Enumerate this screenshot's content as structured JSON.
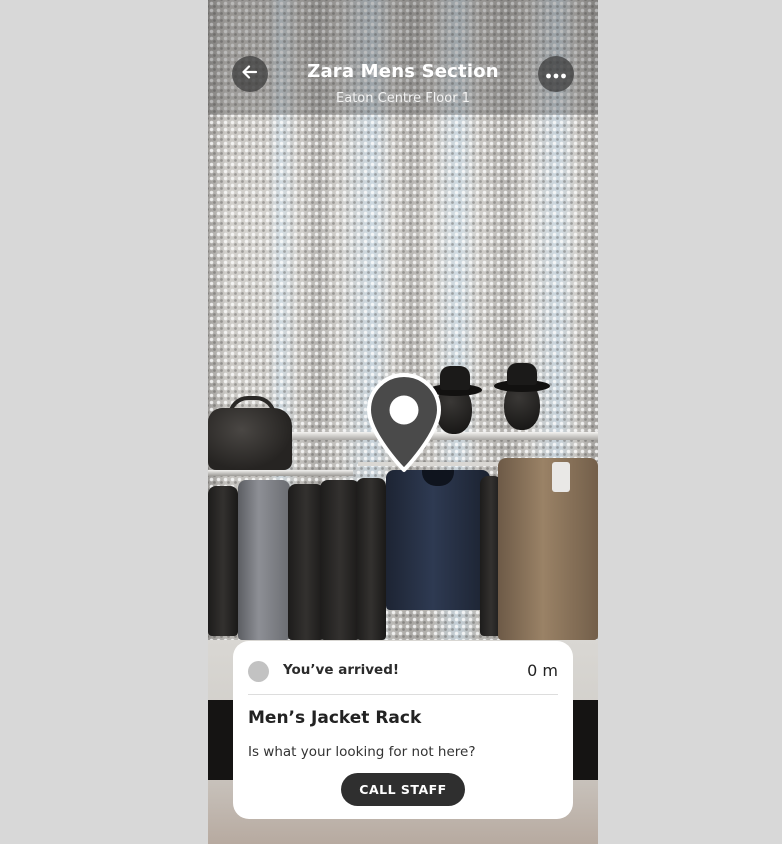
{
  "header": {
    "title": "Zara Mens Section",
    "subtitle": "Eaton Centre Floor 1",
    "back_icon": "arrow-left-icon",
    "more_icon": "ellipsis-icon"
  },
  "map_pin": {
    "icon": "location-pin-icon"
  },
  "arrival_card": {
    "status_text": "You’ve arrived!",
    "distance": "0 m",
    "place_name": "Men’s Jacket Rack",
    "question": "Is what your looking for not here?",
    "call_button_label": "CALL STAFF"
  },
  "colors": {
    "header_overlay": "#464646",
    "card_background": "#ffffff",
    "button_background": "#2f2f2f",
    "status_dot": "#c2c2c2"
  }
}
